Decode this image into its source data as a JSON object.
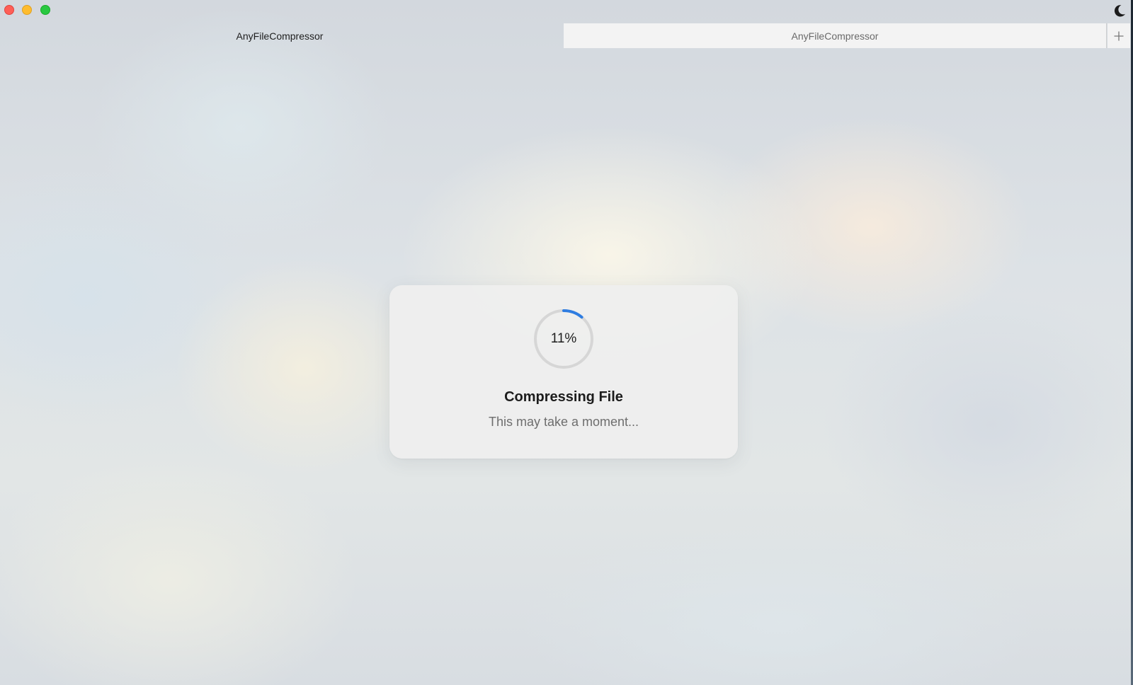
{
  "window": {
    "controls": [
      "close",
      "minimize",
      "zoom"
    ],
    "theme_toggle_icon": "moon-icon"
  },
  "tabs": [
    {
      "label": "AnyFileCompressor",
      "active": true
    },
    {
      "label": "AnyFileCompressor",
      "active": false
    }
  ],
  "new_tab_icon": "plus-icon",
  "progress": {
    "percent": 11,
    "percent_label": "11%",
    "title": "Compressing File",
    "subtitle": "This may take a moment...",
    "accent_color": "#2f7de1",
    "track_color": "#d6d6d6"
  }
}
